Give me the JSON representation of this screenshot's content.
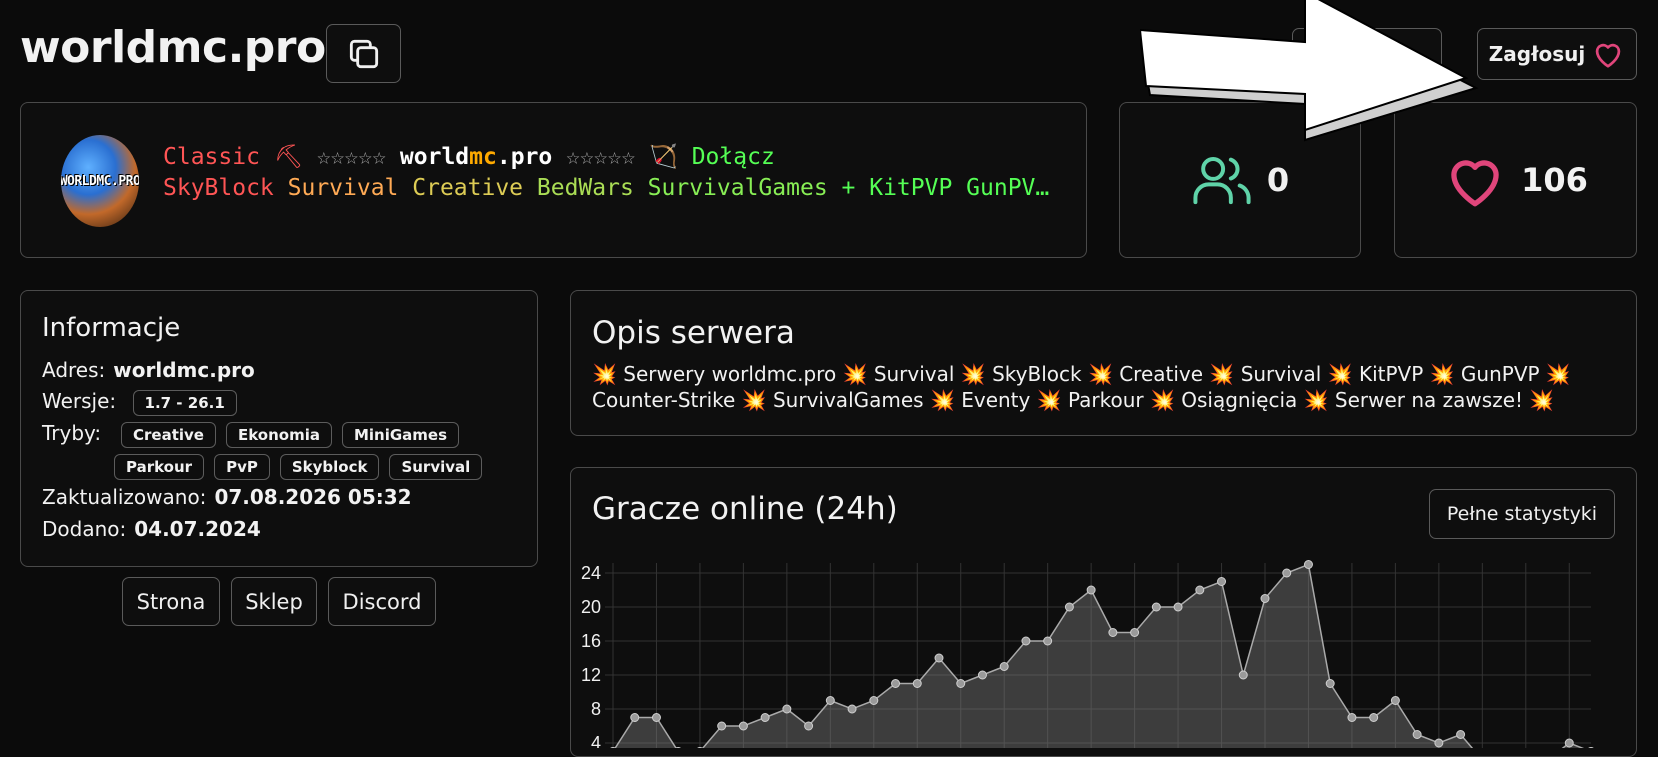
{
  "header": {
    "title": "worldmc.pro",
    "vote_label": "Zagłosuj"
  },
  "banner": {
    "logo_text": "WORLDMC.PRO",
    "motd_line1": [
      {
        "text": "Classic ⛏ ",
        "color": "#ff5555"
      },
      {
        "text": "☆☆☆☆☆ ",
        "color": "#aaaaaa"
      },
      {
        "text": "world",
        "color": "#ffffff"
      },
      {
        "text": "mc",
        "color": "#ffaa00"
      },
      {
        "text": ".pro",
        "color": "#ffffff"
      },
      {
        "text": " ☆☆☆☆☆ ",
        "color": "#aaaaaa"
      },
      {
        "text": "🏹 ",
        "color": "#ff5555"
      },
      {
        "text": "Dołącz",
        "color": "#55ff55"
      }
    ],
    "motd_line2": [
      {
        "text": "SkyBlock ",
        "color": "#ff5555"
      },
      {
        "text": "Survival ",
        "color": "#ffaa55"
      },
      {
        "text": "Creative ",
        "color": "#ddcc55"
      },
      {
        "text": "BedWars ",
        "color": "#aadd55"
      },
      {
        "text": "SurvivalGames ",
        "color": "#88ee55"
      },
      {
        "text": "+ KitPVP GunPV…",
        "color": "#55ff55"
      }
    ]
  },
  "stats": {
    "players": "0",
    "votes": "106",
    "players_color": "#5fd3a8",
    "votes_color": "#e0457b"
  },
  "info": {
    "heading": "Informacje",
    "address_label": "Adres:",
    "address_value": "worldmc.pro",
    "versions_label": "Wersje:",
    "versions_value": "1.7 - 26.1",
    "modes_label": "Tryby:",
    "modes": [
      "Creative",
      "Ekonomia",
      "MiniGames",
      "Parkour",
      "PvP",
      "Skyblock",
      "Survival"
    ],
    "updated_label": "Zaktualizowano:",
    "updated_value": "07.08.2026 05:32",
    "added_label": "Dodano:",
    "added_value": "04.07.2024"
  },
  "links": [
    "Strona",
    "Sklep",
    "Discord"
  ],
  "description": {
    "heading": "Opis serwera",
    "items": [
      "Serwery worldmc.pro",
      "Survival",
      "SkyBlock",
      "Creative",
      "Survival",
      "KitPVP",
      "GunPVP",
      "Counter-Strike",
      "SurvivalGames",
      "Eventy",
      "Parkour",
      "Osiągnięcia",
      "Serwer na zawsze!"
    ],
    "separator": "💥"
  },
  "players_chart": {
    "heading": "Gracze online (24h)",
    "stats_button": "Pełne statystyki"
  },
  "chart_data": {
    "type": "area",
    "title": "Gracze online (24h)",
    "ylim": [
      0,
      24
    ],
    "yticks": [
      "24",
      "20",
      "16",
      "12",
      "8",
      "4"
    ],
    "values": [
      3,
      7,
      7,
      3,
      3,
      6,
      6,
      7,
      8,
      6,
      9,
      8,
      9,
      11,
      11,
      14,
      11,
      12,
      13,
      16,
      16,
      20,
      22,
      17,
      17,
      20,
      20,
      22,
      23,
      12,
      21,
      24,
      25,
      11,
      7,
      7,
      9,
      5,
      4,
      5,
      2,
      2,
      2,
      2,
      4,
      3
    ]
  }
}
